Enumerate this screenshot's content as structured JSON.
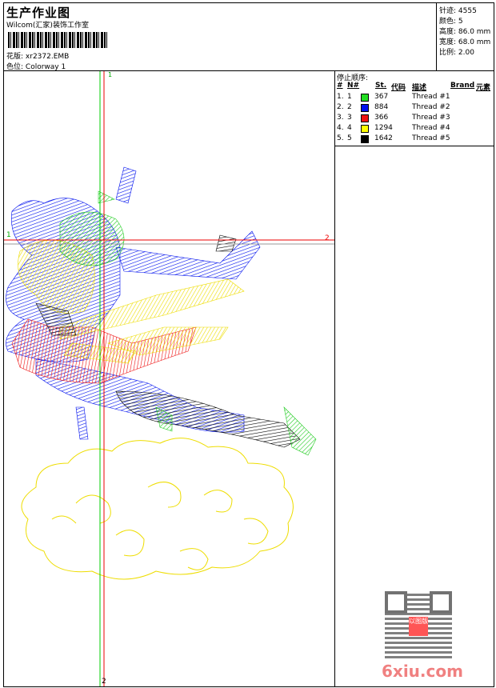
{
  "header": {
    "title": "生产作业图",
    "company": "Wilcom(汇家)装饰工作室",
    "design_label": "花版:",
    "design_value": "xr2372.EMB",
    "colorway_label": "色位:",
    "colorway_value": "Colorway 1"
  },
  "info": {
    "stitches": "针迹: 4555",
    "colors": "颜色: 5",
    "height": "高度: 86.0 mm",
    "width": "宽度: 68.0 mm",
    "scale": "比例: 2.00"
  },
  "threads": {
    "title": "停止顺序:",
    "headers": [
      "#",
      "N#",
      "St.",
      "代码",
      "描述",
      "Brand",
      "元素"
    ],
    "rows": [
      {
        "idx": "1.",
        "n": "1",
        "color": "#22dd22",
        "st": "367",
        "desc": "Thread #1"
      },
      {
        "idx": "2.",
        "n": "2",
        "color": "#0010ee",
        "st": "884",
        "desc": "Thread #2"
      },
      {
        "idx": "3.",
        "n": "3",
        "color": "#ee1111",
        "st": "366",
        "desc": "Thread #3"
      },
      {
        "idx": "4.",
        "n": "4",
        "color": "#ffff00",
        "st": "1294",
        "desc": "Thread #4"
      },
      {
        "idx": "5.",
        "n": "5",
        "color": "#000000",
        "st": "1642",
        "desc": "Thread #5"
      }
    ]
  },
  "guides": {
    "v_top": "1",
    "v_bottom": "2",
    "h_left": "1",
    "h_right": "2"
  },
  "watermark": {
    "site": "6xiu.com",
    "stamp": "以图版"
  }
}
